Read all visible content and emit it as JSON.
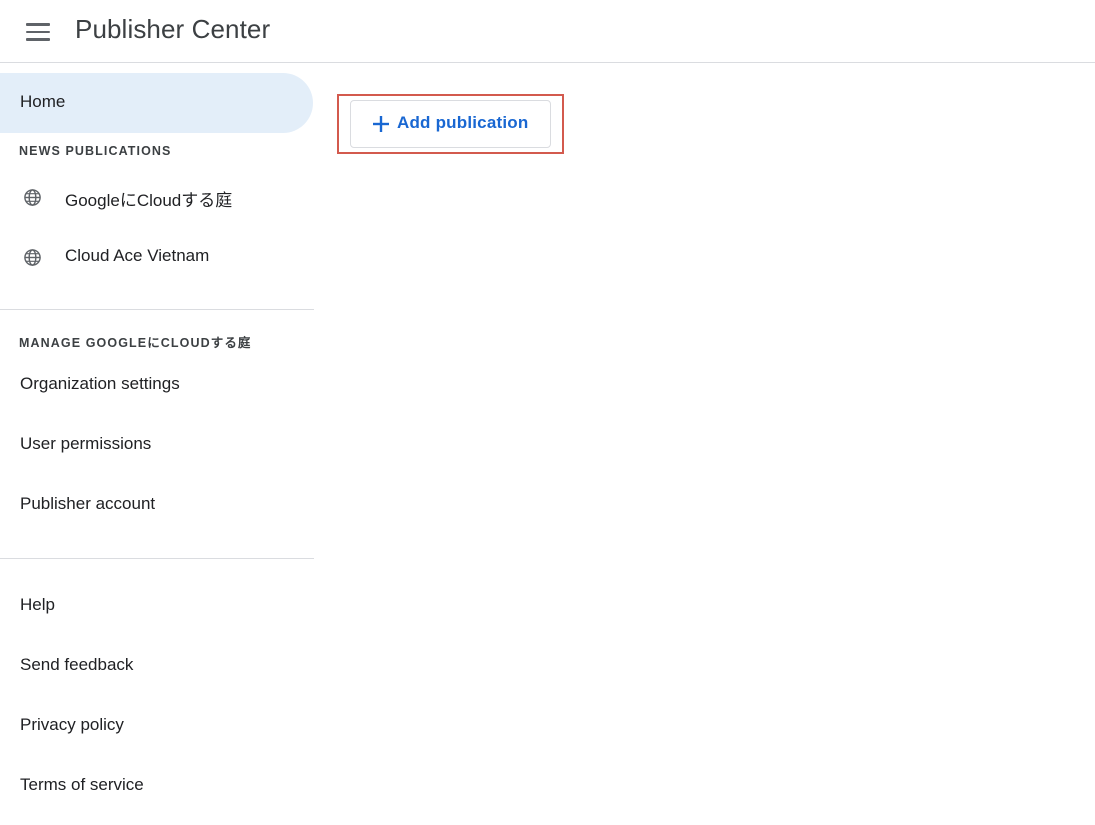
{
  "header": {
    "title": "Publisher Center",
    "menu_icon": "hamburger-menu-icon"
  },
  "sidebar": {
    "home_label": "Home",
    "news_section_title": "NEWS PUBLICATIONS",
    "publications": [
      {
        "label": "GoogleにCloudする庭",
        "icon": "globe-icon"
      },
      {
        "label": "Cloud Ace Vietnam",
        "icon": "globe-icon"
      }
    ],
    "manage_section_title": "MANAGE GOOGLEにCLOUDする庭",
    "manage_items": [
      {
        "label": "Organization settings"
      },
      {
        "label": "User permissions"
      },
      {
        "label": "Publisher account"
      }
    ],
    "footer_items": [
      {
        "label": "Help"
      },
      {
        "label": "Send feedback"
      },
      {
        "label": "Privacy policy"
      },
      {
        "label": "Terms of service"
      }
    ]
  },
  "main": {
    "add_publication_label": "Add publication",
    "add_icon": "plus-icon"
  },
  "colors": {
    "accent": "#1967d2",
    "active_nav_bg": "#e3eef9",
    "highlight_border": "#d35a4e",
    "divider": "#dadce0"
  }
}
